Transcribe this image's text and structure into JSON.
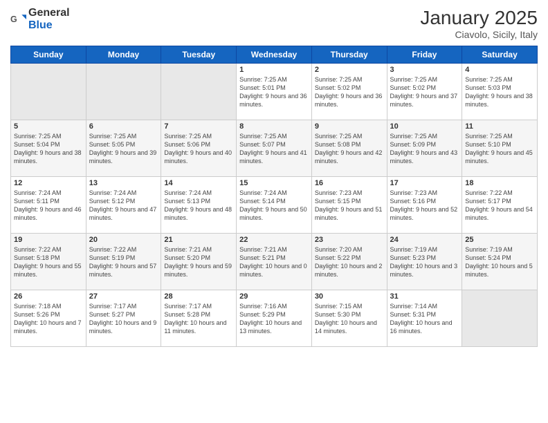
{
  "header": {
    "logo_general": "General",
    "logo_blue": "Blue",
    "title": "January 2025",
    "subtitle": "Ciavolo, Sicily, Italy"
  },
  "weekdays": [
    "Sunday",
    "Monday",
    "Tuesday",
    "Wednesday",
    "Thursday",
    "Friday",
    "Saturday"
  ],
  "weeks": [
    [
      {
        "day": "",
        "info": ""
      },
      {
        "day": "",
        "info": ""
      },
      {
        "day": "",
        "info": ""
      },
      {
        "day": "1",
        "info": "Sunrise: 7:25 AM\nSunset: 5:01 PM\nDaylight: 9 hours and 36 minutes."
      },
      {
        "day": "2",
        "info": "Sunrise: 7:25 AM\nSunset: 5:02 PM\nDaylight: 9 hours and 36 minutes."
      },
      {
        "day": "3",
        "info": "Sunrise: 7:25 AM\nSunset: 5:02 PM\nDaylight: 9 hours and 37 minutes."
      },
      {
        "day": "4",
        "info": "Sunrise: 7:25 AM\nSunset: 5:03 PM\nDaylight: 9 hours and 38 minutes."
      }
    ],
    [
      {
        "day": "5",
        "info": "Sunrise: 7:25 AM\nSunset: 5:04 PM\nDaylight: 9 hours and 38 minutes."
      },
      {
        "day": "6",
        "info": "Sunrise: 7:25 AM\nSunset: 5:05 PM\nDaylight: 9 hours and 39 minutes."
      },
      {
        "day": "7",
        "info": "Sunrise: 7:25 AM\nSunset: 5:06 PM\nDaylight: 9 hours and 40 minutes."
      },
      {
        "day": "8",
        "info": "Sunrise: 7:25 AM\nSunset: 5:07 PM\nDaylight: 9 hours and 41 minutes."
      },
      {
        "day": "9",
        "info": "Sunrise: 7:25 AM\nSunset: 5:08 PM\nDaylight: 9 hours and 42 minutes."
      },
      {
        "day": "10",
        "info": "Sunrise: 7:25 AM\nSunset: 5:09 PM\nDaylight: 9 hours and 43 minutes."
      },
      {
        "day": "11",
        "info": "Sunrise: 7:25 AM\nSunset: 5:10 PM\nDaylight: 9 hours and 45 minutes."
      }
    ],
    [
      {
        "day": "12",
        "info": "Sunrise: 7:24 AM\nSunset: 5:11 PM\nDaylight: 9 hours and 46 minutes."
      },
      {
        "day": "13",
        "info": "Sunrise: 7:24 AM\nSunset: 5:12 PM\nDaylight: 9 hours and 47 minutes."
      },
      {
        "day": "14",
        "info": "Sunrise: 7:24 AM\nSunset: 5:13 PM\nDaylight: 9 hours and 48 minutes."
      },
      {
        "day": "15",
        "info": "Sunrise: 7:24 AM\nSunset: 5:14 PM\nDaylight: 9 hours and 50 minutes."
      },
      {
        "day": "16",
        "info": "Sunrise: 7:23 AM\nSunset: 5:15 PM\nDaylight: 9 hours and 51 minutes."
      },
      {
        "day": "17",
        "info": "Sunrise: 7:23 AM\nSunset: 5:16 PM\nDaylight: 9 hours and 52 minutes."
      },
      {
        "day": "18",
        "info": "Sunrise: 7:22 AM\nSunset: 5:17 PM\nDaylight: 9 hours and 54 minutes."
      }
    ],
    [
      {
        "day": "19",
        "info": "Sunrise: 7:22 AM\nSunset: 5:18 PM\nDaylight: 9 hours and 55 minutes."
      },
      {
        "day": "20",
        "info": "Sunrise: 7:22 AM\nSunset: 5:19 PM\nDaylight: 9 hours and 57 minutes."
      },
      {
        "day": "21",
        "info": "Sunrise: 7:21 AM\nSunset: 5:20 PM\nDaylight: 9 hours and 59 minutes."
      },
      {
        "day": "22",
        "info": "Sunrise: 7:21 AM\nSunset: 5:21 PM\nDaylight: 10 hours and 0 minutes."
      },
      {
        "day": "23",
        "info": "Sunrise: 7:20 AM\nSunset: 5:22 PM\nDaylight: 10 hours and 2 minutes."
      },
      {
        "day": "24",
        "info": "Sunrise: 7:19 AM\nSunset: 5:23 PM\nDaylight: 10 hours and 3 minutes."
      },
      {
        "day": "25",
        "info": "Sunrise: 7:19 AM\nSunset: 5:24 PM\nDaylight: 10 hours and 5 minutes."
      }
    ],
    [
      {
        "day": "26",
        "info": "Sunrise: 7:18 AM\nSunset: 5:26 PM\nDaylight: 10 hours and 7 minutes."
      },
      {
        "day": "27",
        "info": "Sunrise: 7:17 AM\nSunset: 5:27 PM\nDaylight: 10 hours and 9 minutes."
      },
      {
        "day": "28",
        "info": "Sunrise: 7:17 AM\nSunset: 5:28 PM\nDaylight: 10 hours and 11 minutes."
      },
      {
        "day": "29",
        "info": "Sunrise: 7:16 AM\nSunset: 5:29 PM\nDaylight: 10 hours and 13 minutes."
      },
      {
        "day": "30",
        "info": "Sunrise: 7:15 AM\nSunset: 5:30 PM\nDaylight: 10 hours and 14 minutes."
      },
      {
        "day": "31",
        "info": "Sunrise: 7:14 AM\nSunset: 5:31 PM\nDaylight: 10 hours and 16 minutes."
      },
      {
        "day": "",
        "info": ""
      }
    ]
  ]
}
